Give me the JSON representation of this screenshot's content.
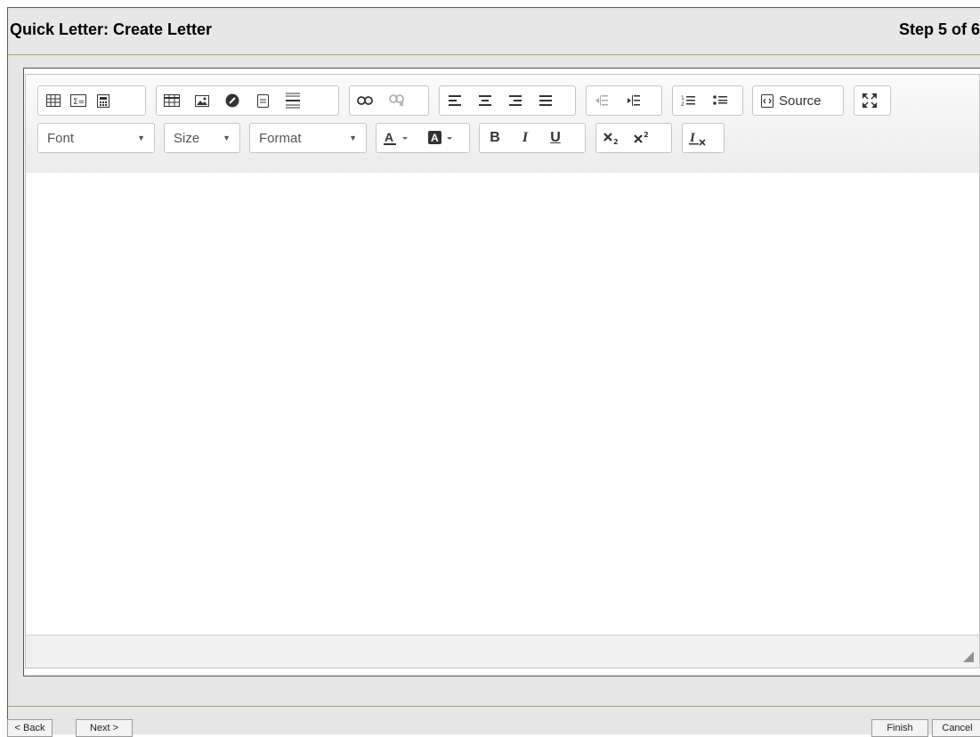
{
  "header": {
    "title": "Quick Letter: Create Letter",
    "step": "Step 5 of 6"
  },
  "toolbar": {
    "font_label": "Font",
    "size_label": "Size",
    "format_label": "Format",
    "source_label": "Source",
    "bold": "B",
    "italic": "I",
    "underline": "U"
  },
  "footer": {
    "back": "< Back",
    "next": "Next >",
    "finish": "Finish",
    "cancel": "Cancel"
  },
  "colors": {
    "accent_line": "#a9a27c",
    "frame_bg": "#e6e6e6"
  }
}
